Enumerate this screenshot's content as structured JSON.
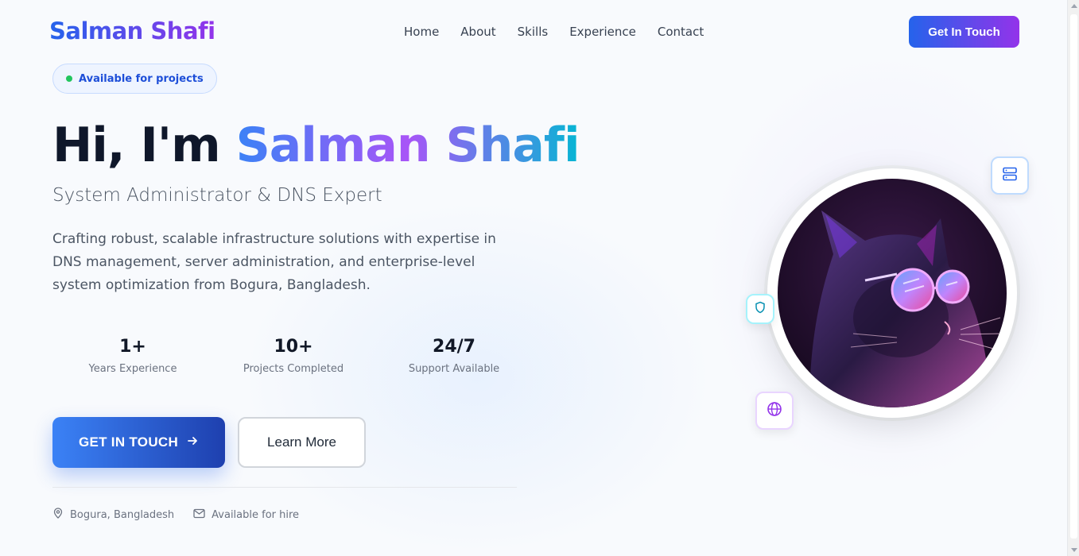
{
  "brand": {
    "name": "Salman Shafi"
  },
  "nav": {
    "items": [
      "Home",
      "About",
      "Skills",
      "Experience",
      "Contact"
    ],
    "cta": "Get In Touch"
  },
  "hero": {
    "badge": "Available for projects",
    "greeting": "Hi, I'm ",
    "name": "Salman Shafi",
    "subtitle": "System Administrator & DNS Expert",
    "description": "Crafting robust, scalable infrastructure solutions with expertise in DNS management, server administration, and enterprise-level system optimization from Bogura, Bangladesh.",
    "stats": [
      {
        "value": "1+",
        "label": "Years Experience"
      },
      {
        "value": "10+",
        "label": "Projects Completed"
      },
      {
        "value": "24/7",
        "label": "Support Available"
      }
    ],
    "primary_button": "GET IN TOUCH",
    "secondary_button": "Learn More",
    "location": "Bogura, Bangladesh",
    "availability": "Available for hire"
  },
  "colors": {
    "accent_blue": "#2563eb",
    "accent_purple": "#9333ea",
    "status_green": "#22c55e"
  },
  "icons": {
    "floating": [
      "server-icon",
      "shield-icon",
      "globe-icon"
    ],
    "avatar": "cat-with-neon-glasses"
  }
}
